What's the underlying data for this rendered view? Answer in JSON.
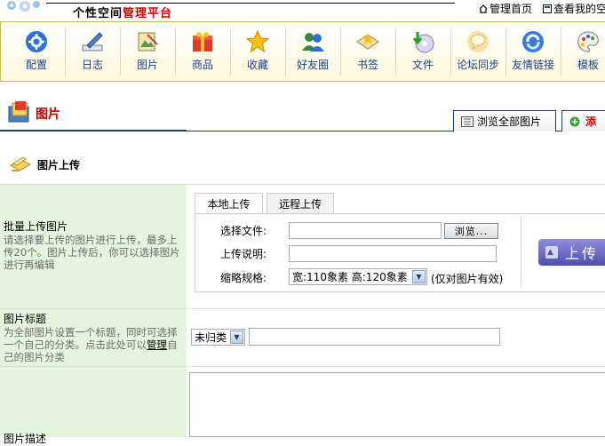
{
  "header": {
    "title_plain": "个性空间",
    "title_red": "管理平台",
    "links": [
      {
        "label": "管理首页",
        "icon": "home-icon"
      },
      {
        "label": "查看我的空",
        "icon": "view-space-icon"
      }
    ]
  },
  "toolbar": {
    "items": [
      {
        "label": "配置",
        "icon": "gear-icon"
      },
      {
        "label": "日志",
        "icon": "pen-icon"
      },
      {
        "label": "图片",
        "icon": "picture-icon"
      },
      {
        "label": "商品",
        "icon": "gift-icon"
      },
      {
        "label": "收藏",
        "icon": "star-icon"
      },
      {
        "label": "好友圈",
        "icon": "friends-icon"
      },
      {
        "label": "书签",
        "icon": "bookmark-icon"
      },
      {
        "label": "文件",
        "icon": "file-download-icon"
      },
      {
        "label": "论坛同步",
        "icon": "forum-sync-icon"
      },
      {
        "label": "友情链接",
        "icon": "link-icon"
      },
      {
        "label": "模板",
        "icon": "palette-icon"
      }
    ]
  },
  "page": {
    "title": "图片",
    "tabs": [
      {
        "label": "浏览全部图片"
      },
      {
        "label": "添"
      }
    ]
  },
  "section": {
    "title": "图片上传"
  },
  "batch": {
    "title": "批量上传图片",
    "desc": "请选择要上传的图片进行上传，最多上传20个。图片上传后，你可以选择图片进行再编辑"
  },
  "upload_tabs": [
    {
      "label": "本地上传",
      "active": true
    },
    {
      "label": "远程上传",
      "active": false
    }
  ],
  "fields": {
    "file_label": "选择文件:",
    "browse_label": "浏览...",
    "desc_label": "上传说明:",
    "thumb_label": "缩略规格:",
    "thumb_value": "宽:110象素  高:120象素",
    "thumb_note": "(仅对图片有效)"
  },
  "upload_button": "上传",
  "title_row": {
    "title": "图片标题",
    "desc_pre": "为全部图片设置一个标题，同时可选择一个自己的分类。点击此处可以",
    "manage_link": "管理",
    "desc_post": "自己的图片分类",
    "category_value": "未归类"
  },
  "desc_row": {
    "title": "图片描述"
  },
  "colors": {
    "accent_red": "#d40000",
    "nav_blue": "#1a3f8a",
    "left_col_bg": "#e3f5dd",
    "upload_btn": "#5a5ab4"
  }
}
